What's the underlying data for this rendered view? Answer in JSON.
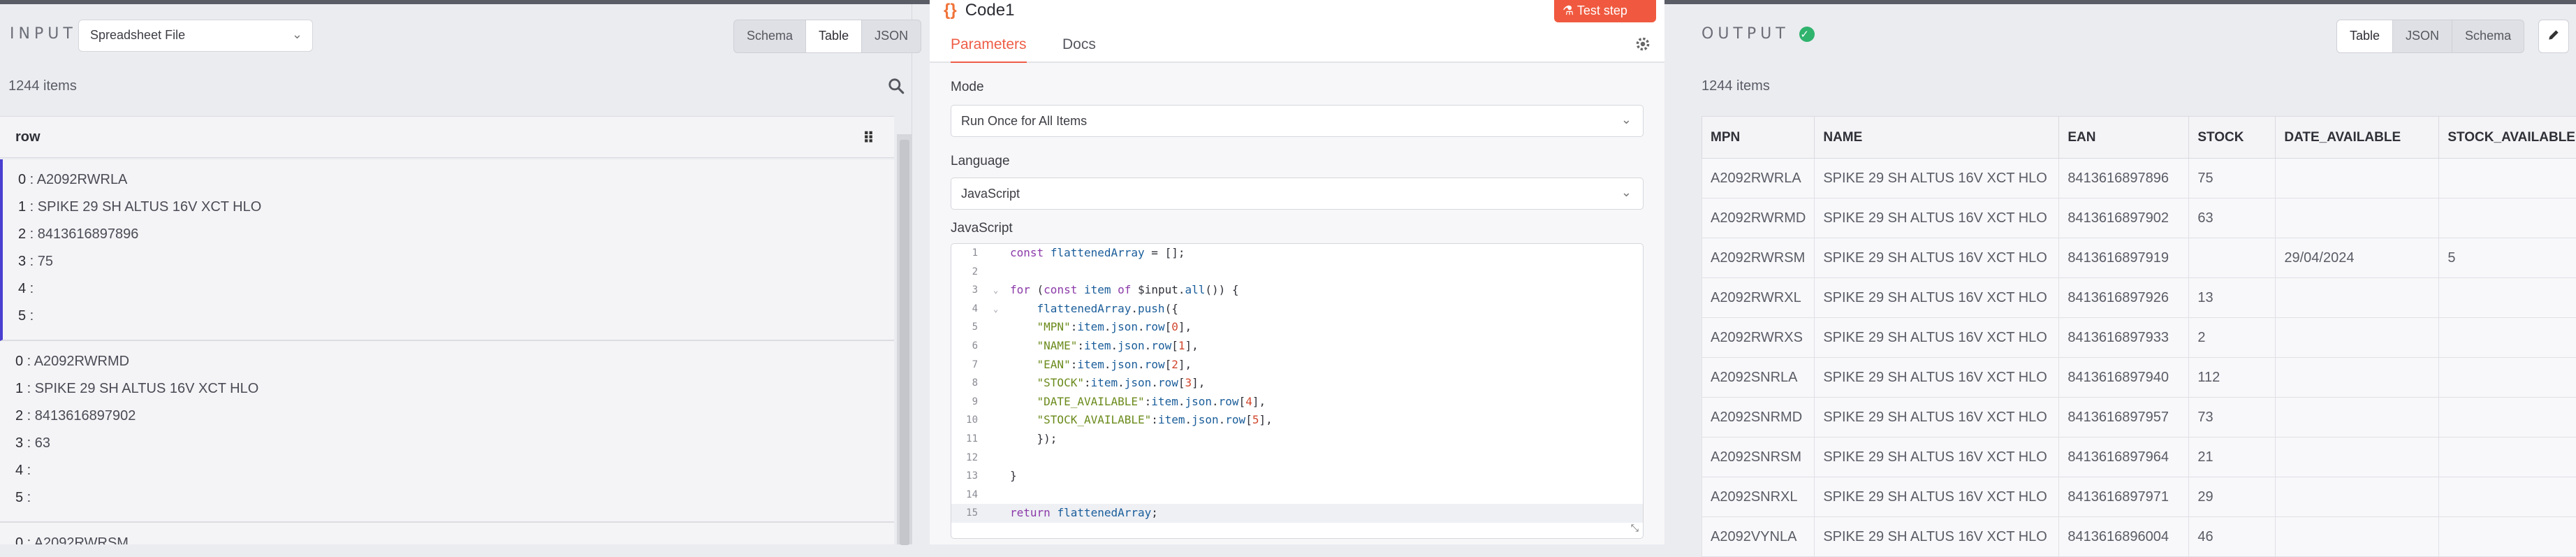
{
  "input": {
    "label": "INPUT",
    "file_select": "Spreadsheet File",
    "views": [
      "Schema",
      "Table",
      "JSON"
    ],
    "active_view": "Table",
    "count": "1244 items",
    "column": "row",
    "groups": [
      {
        "lines": [
          [
            "0",
            "A2092RWRLA"
          ],
          [
            "1",
            "SPIKE 29 SH ALTUS 16V XCT HLO"
          ],
          [
            "2",
            "8413616897896"
          ],
          [
            "3",
            "75"
          ],
          [
            "4",
            ""
          ],
          [
            "5",
            ""
          ]
        ]
      },
      {
        "lines": [
          [
            "0",
            "A2092RWRMD"
          ],
          [
            "1",
            "SPIKE 29 SH ALTUS 16V XCT HLO"
          ],
          [
            "2",
            "8413616897902"
          ],
          [
            "3",
            "63"
          ],
          [
            "4",
            ""
          ],
          [
            "5",
            ""
          ]
        ]
      },
      {
        "lines": [
          [
            "0",
            "A2092RWRSM"
          ]
        ]
      }
    ]
  },
  "editor": {
    "title": "Code1",
    "test_button": "Test step",
    "tabs": [
      "Parameters",
      "Docs"
    ],
    "active_tab": "Parameters",
    "mode_label": "Mode",
    "mode_value": "Run Once for All Items",
    "language_label": "Language",
    "language_value": "JavaScript",
    "code_label": "JavaScript",
    "code_lines": [
      "const flattenedArray = [];",
      "",
      "for (const item of $input.all()) {",
      "    flattenedArray.push({",
      "    \"MPN\":item.json.row[0],",
      "    \"NAME\":item.json.row[1],",
      "    \"EAN\":item.json.row[2],",
      "    \"STOCK\":item.json.row[3],",
      "    \"DATE_AVAILABLE\":item.json.row[4],",
      "    \"STOCK_AVAILABLE\":item.json.row[5],",
      "    });",
      "",
      "}",
      "",
      "return flattenedArray;"
    ]
  },
  "output": {
    "label": "OUTPUT",
    "views": [
      "Table",
      "JSON",
      "Schema"
    ],
    "active_view": "Table",
    "count": "1244 items",
    "columns": [
      "MPN",
      "NAME",
      "EAN",
      "STOCK",
      "DATE_AVAILABLE",
      "STOCK_AVAILABLE"
    ],
    "rows": [
      [
        "A2092RWRLA",
        "SPIKE 29 SH ALTUS 16V XCT HLO",
        "8413616897896",
        "75",
        "",
        ""
      ],
      [
        "A2092RWRMD",
        "SPIKE 29 SH ALTUS 16V XCT HLO",
        "8413616897902",
        "63",
        "",
        ""
      ],
      [
        "A2092RWRSM",
        "SPIKE 29 SH ALTUS 16V XCT HLO",
        "8413616897919",
        "",
        "29/04/2024",
        "5"
      ],
      [
        "A2092RWRXL",
        "SPIKE 29 SH ALTUS 16V XCT HLO",
        "8413616897926",
        "13",
        "",
        ""
      ],
      [
        "A2092RWRXS",
        "SPIKE 29 SH ALTUS 16V XCT HLO",
        "8413616897933",
        "2",
        "",
        ""
      ],
      [
        "A2092SNRLA",
        "SPIKE 29 SH ALTUS 16V XCT HLO",
        "8413616897940",
        "112",
        "",
        ""
      ],
      [
        "A2092SNRMD",
        "SPIKE 29 SH ALTUS 16V XCT HLO",
        "8413616897957",
        "73",
        "",
        ""
      ],
      [
        "A2092SNRSM",
        "SPIKE 29 SH ALTUS 16V XCT HLO",
        "8413616897964",
        "21",
        "",
        ""
      ],
      [
        "A2092SNRXL",
        "SPIKE 29 SH ALTUS 16V XCT HLO",
        "8413616897971",
        "29",
        "",
        ""
      ],
      [
        "A2092VYNLA",
        "SPIKE 29 SH ALTUS 16V XCT HLO",
        "8413616896004",
        "46",
        "",
        ""
      ]
    ]
  },
  "colors": {
    "accent": "#ee5d46",
    "success": "#2fb36d",
    "selection": "#4a3fd0"
  }
}
